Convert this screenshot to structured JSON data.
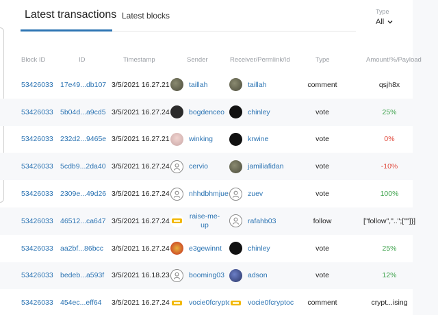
{
  "tabs": {
    "latest_transactions": "Latest transactions",
    "latest_blocks": "Latest blocks"
  },
  "filter": {
    "label": "Type",
    "value": "All"
  },
  "columns": {
    "block_id": "Block ID",
    "id": "ID",
    "timestamp": "Timestamp",
    "sender": "Sender",
    "receiver": "Receiver/Permlink/Id",
    "type": "Type",
    "amount": "Amount/%/Payload"
  },
  "rows": [
    {
      "block_id": "53426033",
      "id": "17e49...db107",
      "timestamp": "3/5/2021 16.27.21",
      "sender": "taillah",
      "sender_avatar": "user-photo-icon",
      "receiver": "taillah",
      "receiver_avatar": "user-photo-icon",
      "type": "comment",
      "amount": "qsjh8x",
      "amount_color": "#222222"
    },
    {
      "block_id": "53426033",
      "id": "5b04d...a9cd5",
      "timestamp": "3/5/2021 16.27.24",
      "sender": "bogdenceo",
      "sender_avatar": "user-photo-icon",
      "receiver": "chinley",
      "receiver_avatar": "user-photo-icon",
      "type": "vote",
      "amount": "25%",
      "amount_color": "#3fa34d"
    },
    {
      "block_id": "53426033",
      "id": "232d2...9465e",
      "timestamp": "3/5/2021 16.27.21",
      "sender": "winking",
      "sender_avatar": "user-photo-icon",
      "receiver": "krwine",
      "receiver_avatar": "user-logo-icon",
      "type": "vote",
      "amount": "0%",
      "amount_color": "#e0473a"
    },
    {
      "block_id": "53426033",
      "id": "5cdb9...2da40",
      "timestamp": "3/5/2021 16.27.24",
      "sender": "cervio",
      "sender_avatar": "default-user-icon",
      "receiver": "jamiliafidan",
      "receiver_avatar": "user-photo-icon",
      "type": "vote",
      "amount": "-10%",
      "amount_color": "#e0473a"
    },
    {
      "block_id": "53426033",
      "id": "2309e...49d26",
      "timestamp": "3/5/2021 16.27.24",
      "sender": "nhhdbhmjue",
      "sender_avatar": "default-user-icon",
      "receiver": "zuev",
      "receiver_avatar": "default-user-icon",
      "type": "vote",
      "amount": "100%",
      "amount_color": "#3fa34d"
    },
    {
      "block_id": "53426033",
      "id": "46512...ca647",
      "timestamp": "3/5/2021 16.27.24",
      "sender": "raise-me-up",
      "sender_avatar": "user-logo-icon",
      "receiver": "rafahb03",
      "receiver_avatar": "default-user-icon",
      "type": "follow",
      "amount": "[\"follow\",\"..\";[\"\"]}]",
      "amount_color": "#222222"
    },
    {
      "block_id": "53426033",
      "id": "aa2bf...86bcc",
      "timestamp": "3/5/2021 16.27.24",
      "sender": "e3gewinnt",
      "sender_avatar": "user-logo-icon",
      "receiver": "chinley",
      "receiver_avatar": "user-photo-icon",
      "type": "vote",
      "amount": "25%",
      "amount_color": "#3fa34d"
    },
    {
      "block_id": "53426033",
      "id": "bedeb...a593f",
      "timestamp": "3/5/2021 16.18.23",
      "sender": "booming03",
      "sender_avatar": "default-user-icon",
      "receiver": "adson",
      "receiver_avatar": "user-photo-icon",
      "type": "vote",
      "amount": "12%",
      "amount_color": "#3fa34d"
    },
    {
      "block_id": "53426033",
      "id": "454ec...eff64",
      "timestamp": "3/5/2021 16.27.24",
      "sender": "vocie0fcrypto",
      "sender_avatar": "user-logo-icon",
      "receiver": "vocie0fcryptoc",
      "receiver_avatar": "user-logo-icon",
      "type": "comment",
      "amount": "crypt...ising",
      "amount_color": "#222222"
    }
  ]
}
